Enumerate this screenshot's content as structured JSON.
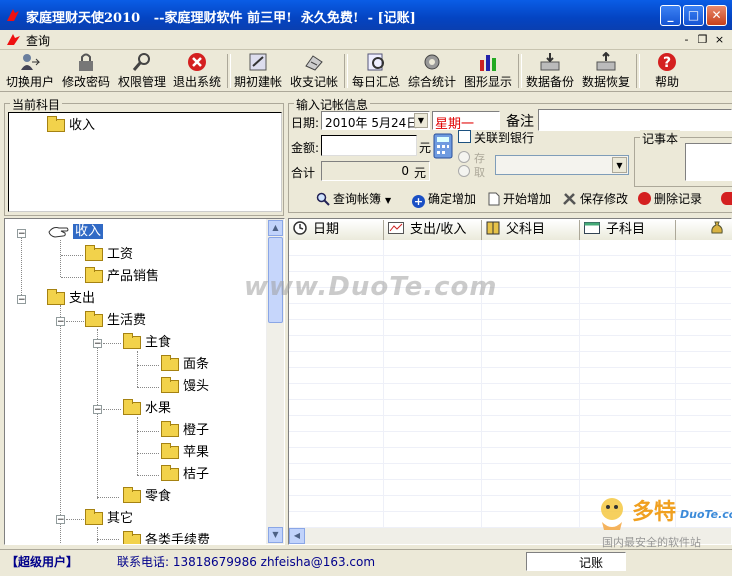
{
  "window": {
    "title": "家庭理财天使2010   --家庭理财软件 前三甲!  永久免费!  - [记账]",
    "controls": {
      "minimize": "_",
      "maximize": "□",
      "close": "✕"
    }
  },
  "menu": {
    "item": "查询",
    "mdi": {
      "minimize": "-",
      "restore": "❐",
      "close": "×"
    }
  },
  "toolbar": {
    "buttons": [
      {
        "label": "切换用户",
        "icon": "switch-user-icon"
      },
      {
        "label": "修改密码",
        "icon": "password-icon"
      },
      {
        "label": "权限管理",
        "icon": "permission-icon"
      },
      {
        "label": "退出系统",
        "icon": "exit-icon"
      },
      {
        "label": "期初建帐",
        "icon": "opening-account-icon"
      },
      {
        "label": "收支记帐",
        "icon": "bookkeeping-icon"
      },
      {
        "label": "每日汇总",
        "icon": "daily-summary-icon"
      },
      {
        "label": "综合统计",
        "icon": "statistics-icon"
      },
      {
        "label": "图形显示",
        "icon": "chart-icon"
      },
      {
        "label": "数据备份",
        "icon": "backup-icon"
      },
      {
        "label": "数据恢复",
        "icon": "restore-icon"
      },
      {
        "label": "帮助",
        "icon": "help-icon"
      }
    ]
  },
  "current_subject": {
    "title": "当前科目",
    "item": "收入"
  },
  "entry": {
    "title": "输入记帐信息",
    "date_label": "日期:",
    "date_value": "2010年 5月24日",
    "weekday": "星期一",
    "note_label": "备注",
    "amount_label": "金额:",
    "amount_unit": "元",
    "total_label": "合计",
    "total_value": "0",
    "total_unit": "元",
    "bank_label": "关联到银行",
    "deposit_label": "存",
    "withdraw_label": "取",
    "memo_title": "记事本"
  },
  "actions": {
    "query_book": "查询帐簿",
    "confirm_add": "确定增加",
    "start_add": "开始增加",
    "save_changes": "保存修改",
    "delete_record": "删除记录"
  },
  "tree": {
    "root_income": "收入",
    "salary": "工资",
    "sales": "产品销售",
    "root_expense": "支出",
    "living": "生活费",
    "staple": "主食",
    "noodles": "面条",
    "buns": "馒头",
    "fruit": "水果",
    "orange": "橙子",
    "apple": "苹果",
    "tangerine": "桔子",
    "snacks": "零食",
    "other": "其它",
    "fees": "各类手续费"
  },
  "grid": {
    "columns": [
      "日期",
      "支出/收入",
      "父科目",
      "子科目"
    ]
  },
  "status": {
    "user": "【超级用户】",
    "contact": "联系电话: 13818679986 zhfeisha@163.com",
    "mode": "记账"
  },
  "watermark": {
    "main": "www.DuoTe.com",
    "logo_cn": "多特",
    "logo_en": "DuoTe.com",
    "logo_tag": "国内最安全的软件站"
  },
  "colors": {
    "title_blue": "#0444c2",
    "weekday_red": "#e00000",
    "tree_select": "#316ac5"
  }
}
